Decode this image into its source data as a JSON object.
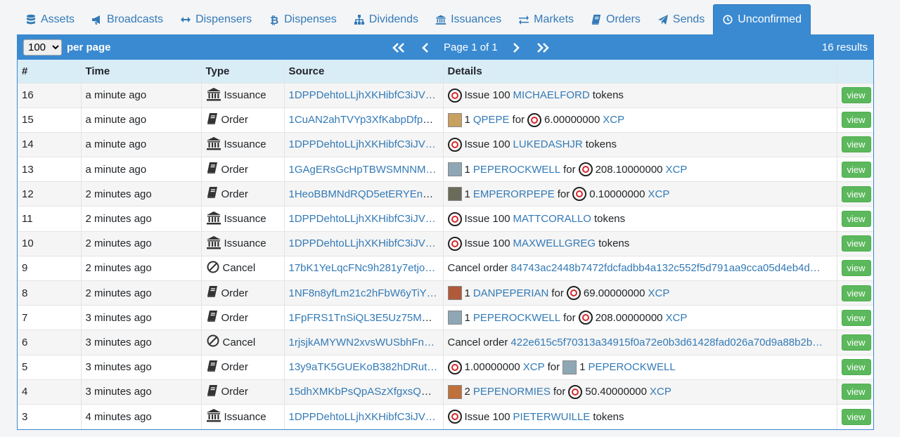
{
  "tabs": [
    {
      "label": "Assets",
      "icon": "database-icon",
      "active": false
    },
    {
      "label": "Broadcasts",
      "icon": "bullhorn-icon",
      "active": false
    },
    {
      "label": "Dispensers",
      "icon": "arrows-horizontal-icon",
      "active": false
    },
    {
      "label": "Dispenses",
      "icon": "bitcoin-icon",
      "active": false
    },
    {
      "label": "Dividends",
      "icon": "sitemap-icon",
      "active": false
    },
    {
      "label": "Issuances",
      "icon": "bank-icon",
      "active": false
    },
    {
      "label": "Markets",
      "icon": "exchange-icon",
      "active": false
    },
    {
      "label": "Orders",
      "icon": "book-icon",
      "active": false
    },
    {
      "label": "Sends",
      "icon": "paper-plane-icon",
      "active": false
    },
    {
      "label": "Unconfirmed",
      "icon": "clock-icon",
      "active": true
    }
  ],
  "toolbar": {
    "per_page_value": "100",
    "per_page_options": [
      "100"
    ],
    "per_page_label": "per page",
    "page_text": "Page 1 of 1",
    "results_text": "16 results"
  },
  "columns": [
    "#",
    "Time",
    "Type",
    "Source",
    "Details"
  ],
  "view_label": "view",
  "colors": {
    "accent": "#3a8ad1",
    "header_row": "#d9edf7",
    "link": "#337ab7",
    "view_button": "#5cb85c"
  },
  "rows": [
    {
      "num": "16",
      "time": "a minute ago",
      "type": "Issuance",
      "type_icon": "bank-icon",
      "source": "1DPPDehtoLLjhXKHibfC3iJV…",
      "details": [
        {
          "k": "xcp"
        },
        {
          "t": "Issue 100"
        },
        {
          "a": "MICHAELFORD"
        },
        {
          "t": "tokens"
        }
      ]
    },
    {
      "num": "15",
      "time": "a minute ago",
      "type": "Order",
      "type_icon": "book-icon",
      "source": "1CuAN2ahTVYp3XfKabpDfpd…",
      "details": [
        {
          "k": "thumb",
          "c": "#c8a060"
        },
        {
          "t": "1"
        },
        {
          "a": "QPEPE"
        },
        {
          "t": "for"
        },
        {
          "k": "xcp"
        },
        {
          "t": "6.00000000"
        },
        {
          "a": "XCP"
        }
      ]
    },
    {
      "num": "14",
      "time": "a minute ago",
      "type": "Issuance",
      "type_icon": "bank-icon",
      "source": "1DPPDehtoLLjhXKHibfC3iJV…",
      "details": [
        {
          "k": "xcp"
        },
        {
          "t": "Issue 100"
        },
        {
          "a": "LUKEDASHJR"
        },
        {
          "t": "tokens"
        }
      ]
    },
    {
      "num": "13",
      "time": "a minute ago",
      "type": "Order",
      "type_icon": "book-icon",
      "source": "1GAgERsGcHpTBWSMNNM…",
      "details": [
        {
          "k": "thumb",
          "c": "#8fa7b5"
        },
        {
          "t": "1"
        },
        {
          "a": "PEPEROCKWELL"
        },
        {
          "t": "for"
        },
        {
          "k": "xcp"
        },
        {
          "t": "208.10000000"
        },
        {
          "a": "XCP"
        }
      ]
    },
    {
      "num": "12",
      "time": "2 minutes ago",
      "type": "Order",
      "type_icon": "book-icon",
      "source": "1HeoBBMNdRQD5etERYEnA…",
      "details": [
        {
          "k": "thumb",
          "c": "#6b6b5a"
        },
        {
          "t": "1"
        },
        {
          "a": "EMPERORPEPE"
        },
        {
          "t": "for"
        },
        {
          "k": "xcp"
        },
        {
          "t": "0.10000000"
        },
        {
          "a": "XCP"
        }
      ]
    },
    {
      "num": "11",
      "time": "2 minutes ago",
      "type": "Issuance",
      "type_icon": "bank-icon",
      "source": "1DPPDehtoLLjhXKHibfC3iJV…",
      "details": [
        {
          "k": "xcp"
        },
        {
          "t": "Issue 100"
        },
        {
          "a": "MATTCORALLO"
        },
        {
          "t": "tokens"
        }
      ]
    },
    {
      "num": "10",
      "time": "2 minutes ago",
      "type": "Issuance",
      "type_icon": "bank-icon",
      "source": "1DPPDehtoLLjhXKHibfC3iJV…",
      "details": [
        {
          "k": "xcp"
        },
        {
          "t": "Issue 100"
        },
        {
          "a": "MAXWELLGREG"
        },
        {
          "t": "tokens"
        }
      ]
    },
    {
      "num": "9",
      "time": "2 minutes ago",
      "type": "Cancel",
      "type_icon": "ban-icon",
      "source": "17bK1YeLqcFNc9h281y7etjo…",
      "details": [
        {
          "t": "Cancel order"
        },
        {
          "a": "84743ac2448b7472fdcfadbb4a132c552f5d791aa9cca05d4eb4d…"
        }
      ]
    },
    {
      "num": "8",
      "time": "2 minutes ago",
      "type": "Order",
      "type_icon": "book-icon",
      "source": "1NF8n8yfLm21c2hFbW6yTiY…",
      "details": [
        {
          "k": "thumb",
          "c": "#b05a3a"
        },
        {
          "t": "1"
        },
        {
          "a": "DANPEPERIAN"
        },
        {
          "t": "for"
        },
        {
          "k": "xcp"
        },
        {
          "t": "69.00000000"
        },
        {
          "a": "XCP"
        }
      ]
    },
    {
      "num": "7",
      "time": "3 minutes ago",
      "type": "Order",
      "type_icon": "book-icon",
      "source": "1FpFRS1TnSiQL3E5Uz75MG…",
      "details": [
        {
          "k": "thumb",
          "c": "#8fa7b5"
        },
        {
          "t": "1"
        },
        {
          "a": "PEPEROCKWELL"
        },
        {
          "t": "for"
        },
        {
          "k": "xcp"
        },
        {
          "t": "208.00000000"
        },
        {
          "a": "XCP"
        }
      ]
    },
    {
      "num": "6",
      "time": "3 minutes ago",
      "type": "Cancel",
      "type_icon": "ban-icon",
      "source": "1rjsjkAMYWN2xvsWUSbhFn…",
      "details": [
        {
          "t": "Cancel order"
        },
        {
          "a": "422e615c5f70313a34915f0a72e0b3d61428fad026a70d9a88b2b…"
        }
      ]
    },
    {
      "num": "5",
      "time": "3 minutes ago",
      "type": "Order",
      "type_icon": "book-icon",
      "source": "13y9aTK5GUEKoB382hDRut…",
      "details": [
        {
          "k": "xcp"
        },
        {
          "t": "1.00000000"
        },
        {
          "a": "XCP"
        },
        {
          "t": "for"
        },
        {
          "k": "thumb",
          "c": "#8fa7b5"
        },
        {
          "t": "1"
        },
        {
          "a": "PEPEROCKWELL"
        }
      ]
    },
    {
      "num": "4",
      "time": "3 minutes ago",
      "type": "Order",
      "type_icon": "book-icon",
      "source": "15dhXMKbPsQpASzXfgxsQC…",
      "details": [
        {
          "k": "thumb",
          "c": "#c0703a"
        },
        {
          "t": "2"
        },
        {
          "a": "PEPENORMIES"
        },
        {
          "t": "for"
        },
        {
          "k": "xcp"
        },
        {
          "t": "50.40000000"
        },
        {
          "a": "XCP"
        }
      ]
    },
    {
      "num": "3",
      "time": "4 minutes ago",
      "type": "Issuance",
      "type_icon": "bank-icon",
      "source": "1DPPDehtoLLjhXKHibfC3iJV…",
      "details": [
        {
          "k": "xcp"
        },
        {
          "t": "Issue 100"
        },
        {
          "a": "PIETERWUILLE"
        },
        {
          "t": "tokens"
        }
      ]
    }
  ]
}
